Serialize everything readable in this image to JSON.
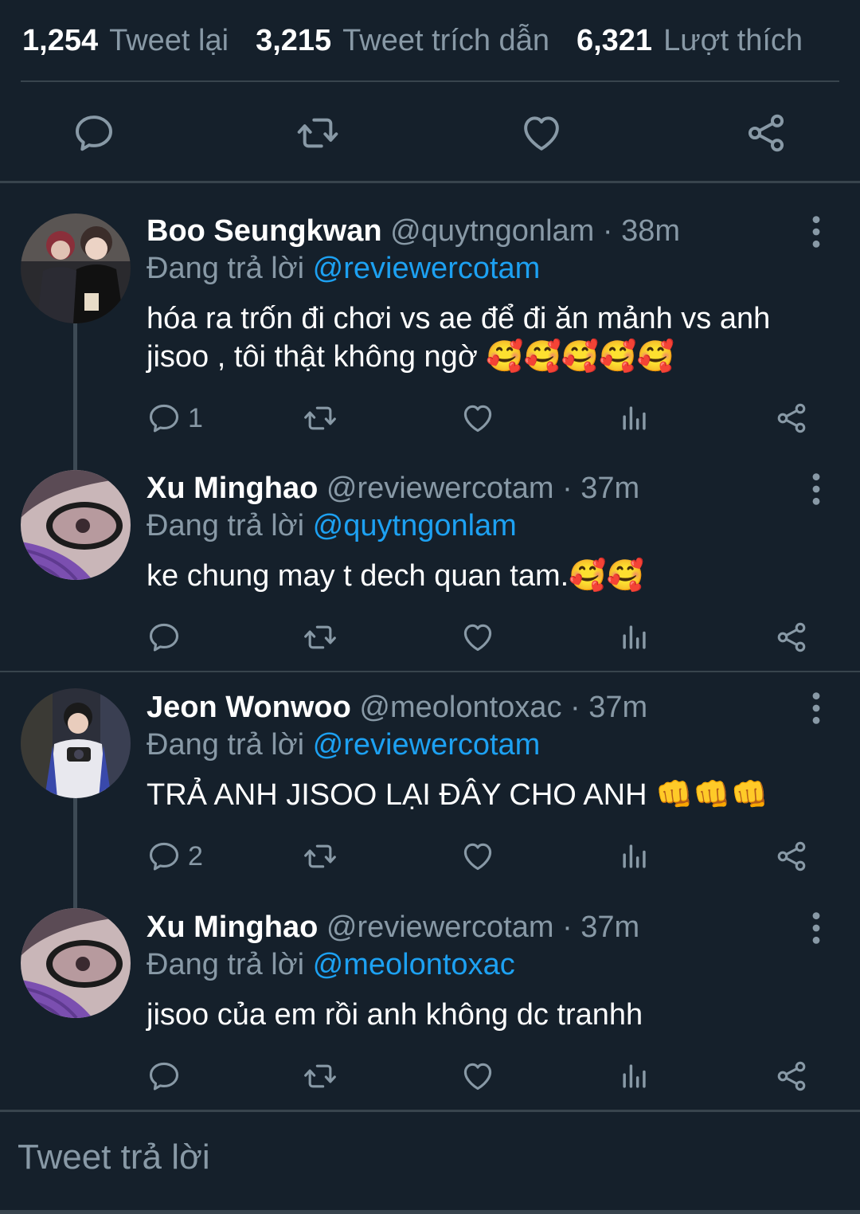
{
  "stats": [
    {
      "count": "1,254",
      "label": "Tweet lại"
    },
    {
      "count": "3,215",
      "label": "Tweet trích dẫn"
    },
    {
      "count": "6,321",
      "label": "Lượt thích"
    }
  ],
  "tweets": [
    {
      "name": "Boo Seungkwan",
      "meta": "@quytngonlam · 38m",
      "reply_prefix": "Đang trả lời",
      "reply_to": "@reviewercotam",
      "text_line1": "hóa ra trốn đi chơi vs ae để đi ăn mảnh vs anh",
      "text_line2": "jisoo , tôi thật không ngờ 🥰🥰🥰🥰🥰",
      "reply_count": "1"
    },
    {
      "name": "Xu Minghao",
      "meta": "@reviewercotam · 37m",
      "reply_prefix": "Đang trả lời",
      "reply_to": "@quytngonlam",
      "text_line1": "ke chung may t dech quan tam.🥰🥰",
      "reply_count": ""
    },
    {
      "name": "Jeon Wonwoo",
      "meta": "@meolontoxac · 37m",
      "reply_prefix": "Đang trả lời",
      "reply_to": "@reviewercotam",
      "text_line1": "TRẢ ANH JISOO LẠI ĐÂY CHO ANH 👊👊👊",
      "reply_count": "2"
    },
    {
      "name": "Xu Minghao",
      "meta": "@reviewercotam · 37m",
      "reply_prefix": "Đang trả lời",
      "reply_to": "@meolontoxac",
      "text_line1": "jisoo của em rồi anh không dc tranhh",
      "reply_count": ""
    }
  ],
  "compose": {
    "placeholder": "Tweet trả lời"
  },
  "colors": {
    "background": "#15202b",
    "secondary_text": "#8899a6",
    "link": "#1da1f2",
    "divider": "#38444d"
  },
  "icons": [
    "reply-icon",
    "retweet-icon",
    "like-icon",
    "share-icon",
    "analytics-icon",
    "more-vertical-icon"
  ]
}
